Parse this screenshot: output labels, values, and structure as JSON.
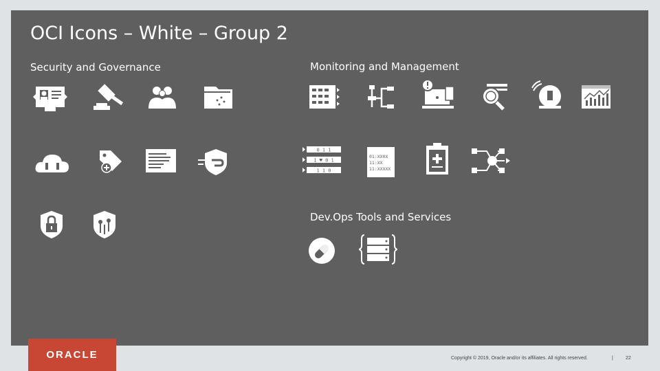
{
  "slide": {
    "title": "OCI Icons – White – Group 2",
    "sections": {
      "security": "Security and Governance",
      "monitoring": "Monitoring and Management",
      "devops": "Dev.Ops Tools and Services"
    }
  },
  "icons": {
    "security": [
      "id-card-icon",
      "gavel-icon",
      "users-icon",
      "folder-icon",
      "cloud-icon",
      "tag-icon",
      "document-icon",
      "shield-icon",
      "lock-icon",
      "shield-keys-icon"
    ],
    "monitoring": [
      "dashboard-list-icon",
      "workflow-icon",
      "alert-laptop-icon",
      "search-report-icon",
      "alarm-bell-icon",
      "chart-monitor-icon",
      "binary-stream-icon",
      "log-document-icon",
      "health-clipboard-icon",
      "network-hub-icon"
    ],
    "devops": [
      "pill-icon",
      "server-braces-icon"
    ]
  },
  "binary_rows": [
    "0 1 1",
    "1 ♥ 0 1",
    "1 1 0"
  ],
  "log_lines": [
    "01:XX0X",
    "11:XX",
    "11:XXXXX"
  ],
  "logo": {
    "text": "ORACLE",
    "color": "#c74634"
  },
  "footer": {
    "copyright": "Copyright © 2019, Oracle and/or its affiliates. All rights reserved.",
    "separator": "|",
    "page_number": "22"
  }
}
